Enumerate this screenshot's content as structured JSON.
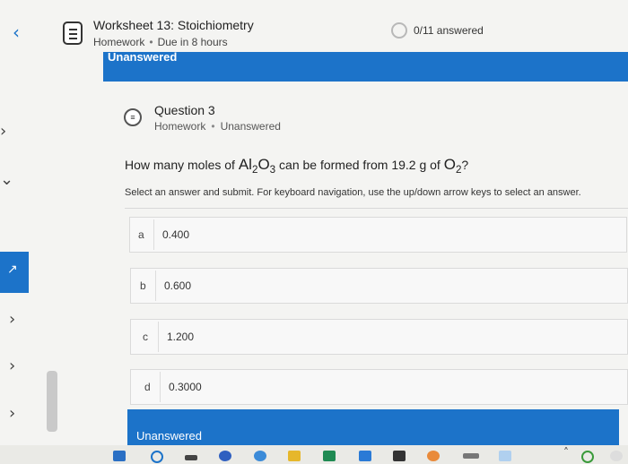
{
  "header": {
    "title": "Worksheet 13: Stoichiometry",
    "type": "Homework",
    "due": "Due in 8 hours",
    "progress": "0/11 answered",
    "icon": "worksheet-icon"
  },
  "banner": {
    "label": "Unanswered"
  },
  "question": {
    "title": "Question 3",
    "type": "Homework",
    "status": "Unanswered",
    "prompt_prefix": "How many moles of ",
    "al": "Al",
    "al_sub": "2",
    "o": "O",
    "o_sub": "3",
    "prompt_mid": " can be formed from 19.2 g of ",
    "o2": "O",
    "o2_sub": "2",
    "prompt_end": "?",
    "instructions": "Select an answer and submit. For keyboard navigation, use the up/down arrow keys to select an answer."
  },
  "options": [
    {
      "letter": "a",
      "value": "0.400"
    },
    {
      "letter": "b",
      "value": "0.600"
    },
    {
      "letter": "c",
      "value": "1.200"
    },
    {
      "letter": "d",
      "value": "0.3000"
    }
  ],
  "footer": {
    "label": "Unanswered"
  },
  "colors": {
    "accent": "#1c73c9",
    "background": "#f4f4f2"
  }
}
